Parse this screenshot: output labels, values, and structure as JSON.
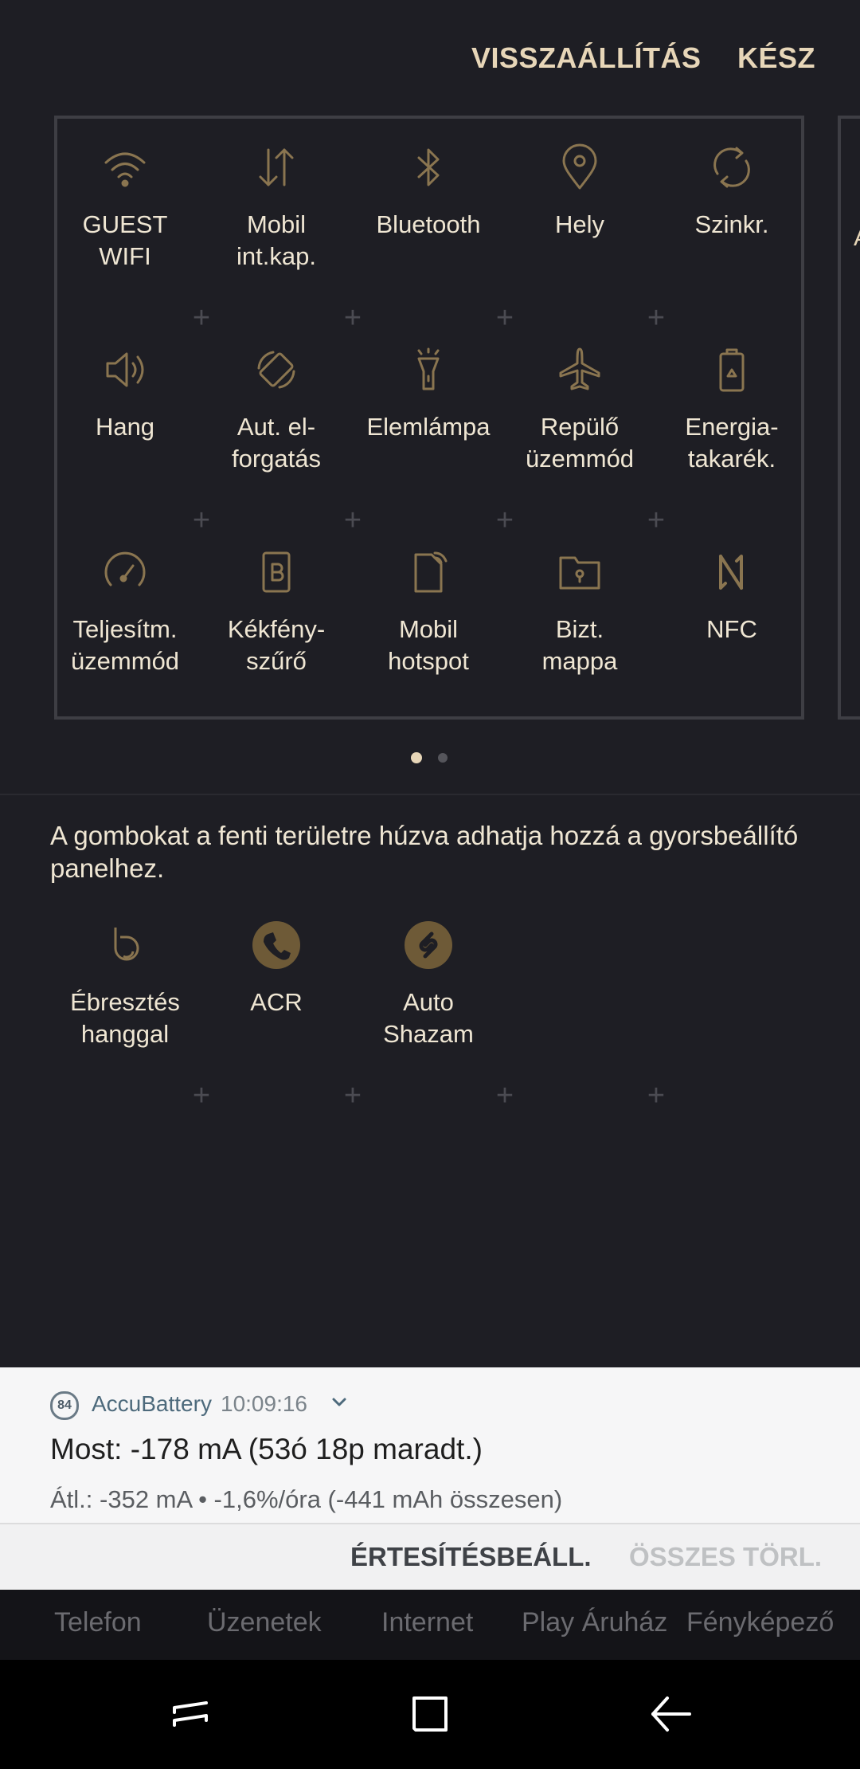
{
  "header": {
    "reset_label": "VISSZAÁLLÍTÁS",
    "done_label": "KÉSZ"
  },
  "panel": {
    "peek_label": "A",
    "tiles": [
      {
        "label_1": "GUEST",
        "label_2": "WIFI",
        "icon": "wifi-icon"
      },
      {
        "label_1": "Mobil",
        "label_2": "int.kap.",
        "icon": "mobile-data-icon"
      },
      {
        "label_1": "Bluetooth",
        "label_2": "",
        "icon": "bluetooth-icon"
      },
      {
        "label_1": "Hely",
        "label_2": "",
        "icon": "location-icon"
      },
      {
        "label_1": "Szinkr.",
        "label_2": "",
        "icon": "sync-icon"
      },
      {
        "label_1": "Hang",
        "label_2": "",
        "icon": "sound-icon"
      },
      {
        "label_1": "Aut. el-",
        "label_2": "forgatás",
        "icon": "auto-rotate-icon"
      },
      {
        "label_1": "Elemlámpa",
        "label_2": "",
        "icon": "flashlight-icon"
      },
      {
        "label_1": "Repülő",
        "label_2": "üzemmód",
        "icon": "airplane-icon"
      },
      {
        "label_1": "Energia-",
        "label_2": "takarék.",
        "icon": "power-saving-icon"
      },
      {
        "label_1": "Teljesítm.",
        "label_2": "üzemmód",
        "icon": "performance-icon"
      },
      {
        "label_1": "Kékfény-",
        "label_2": "szűrő",
        "icon": "blue-light-filter-icon"
      },
      {
        "label_1": "Mobil",
        "label_2": "hotspot",
        "icon": "hotspot-icon"
      },
      {
        "label_1": "Bizt.",
        "label_2": "mappa",
        "icon": "secure-folder-icon"
      },
      {
        "label_1": "NFC",
        "label_2": "",
        "icon": "nfc-icon"
      }
    ]
  },
  "pager": {
    "current_page": 1,
    "total_pages": 2
  },
  "available": {
    "hint": "A gombokat a fenti területre húzva adhatja hozzá a gyorsbeállító panelhez.",
    "tiles": [
      {
        "label_1": "Ébresztés",
        "label_2": "hanggal",
        "icon": "bixby-wakeup-icon"
      },
      {
        "label_1": "ACR",
        "label_2": "",
        "icon": "phone-recorder-icon"
      },
      {
        "label_1": "Auto",
        "label_2": "Shazam",
        "icon": "shazam-icon"
      }
    ]
  },
  "notification": {
    "badge": "84",
    "app_name": "AccuBattery",
    "time": "10:09:16",
    "title": "Most: -178 mA (53ó 18p maradt.)",
    "body": "Átl.: -352 mA • -1,6%/óra (-441 mAh összesen)",
    "action_settings": "ÉRTESÍTÉSBEÁLL.",
    "action_clear": "ÖSSZES TÖRL."
  },
  "dock": {
    "items": [
      "Telefon",
      "Üzenetek",
      "Internet",
      "Play Áruház",
      "Fényképező"
    ]
  },
  "colors": {
    "background": "#1e1e24",
    "icon_gold": "#8a7550",
    "label_cream": "#efe6d3",
    "accent_cream": "#e7d6b8"
  }
}
